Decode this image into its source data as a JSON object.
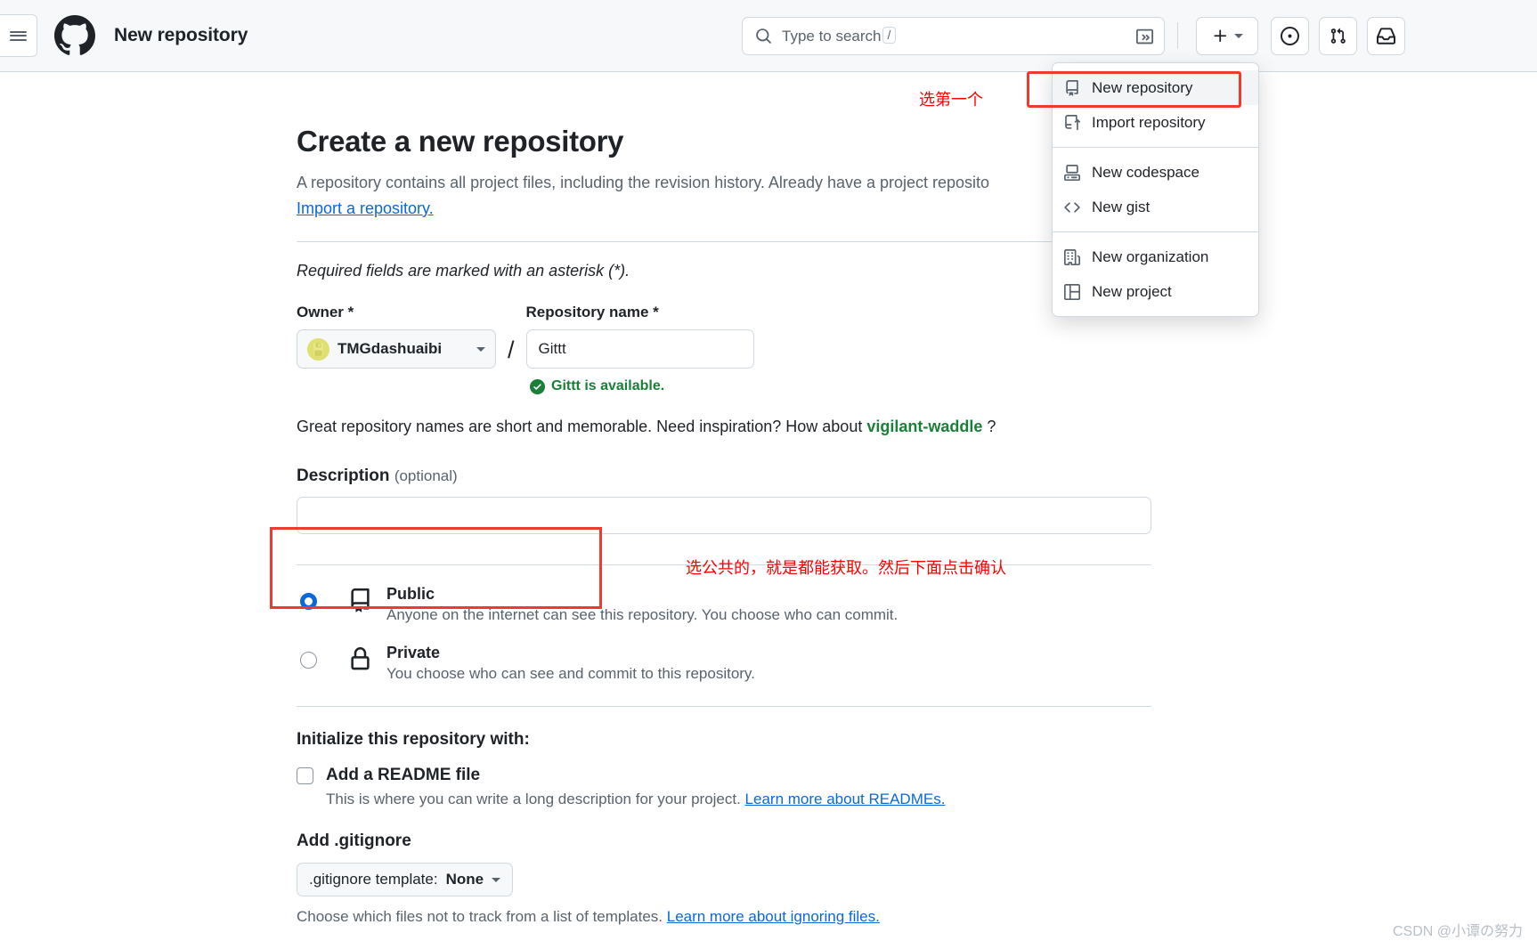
{
  "header": {
    "title": "New repository",
    "menu_icon": "hamburger-icon",
    "logo_icon": "github-logo-icon",
    "buttons": [
      {
        "name": "create-new-button",
        "icon": "plus-icon",
        "has_caret": true
      },
      {
        "name": "issues-button",
        "icon": "issue-opened-icon"
      },
      {
        "name": "pull-requests-button",
        "icon": "git-pull-request-icon"
      },
      {
        "name": "notifications-button",
        "icon": "inbox-icon"
      }
    ]
  },
  "search": {
    "placeholder": "Type to search",
    "shortcut_key": "/",
    "icon": "search-icon",
    "command_icon": "terminal-icon"
  },
  "dropdown": {
    "groups": [
      {
        "items": [
          {
            "label": "New repository",
            "icon": "repo-icon",
            "active": true
          },
          {
            "label": "Import repository",
            "icon": "repo-push-icon",
            "active": false
          }
        ]
      },
      {
        "items": [
          {
            "label": "New codespace",
            "icon": "codespaces-icon",
            "active": false
          },
          {
            "label": "New gist",
            "icon": "code-icon",
            "active": false
          }
        ]
      },
      {
        "items": [
          {
            "label": "New organization",
            "icon": "organization-icon",
            "active": false
          },
          {
            "label": "New project",
            "icon": "project-icon",
            "active": false
          }
        ]
      }
    ]
  },
  "main": {
    "title": "Create a new repository",
    "lede_text": "A repository contains all project files, including the revision history. Already have a project reposito",
    "lede_link": "Import a repository.",
    "required_note": "Required fields are marked with an asterisk (*).",
    "owner": {
      "label": "Owner *",
      "value": "TMGdashuaibi"
    },
    "separator": "/",
    "repo_name": {
      "label": "Repository name *",
      "value": "Gittt"
    },
    "availability": {
      "text": "Gittt is available.",
      "icon": "check-circle-fill-icon",
      "color": "#1a7f37"
    },
    "inspiration": {
      "prefix": "Great repository names are short and memorable. Need inspiration? How about ",
      "suggestion": "vigilant-waddle",
      "suffix": " ?"
    },
    "description": {
      "label": "Description",
      "optional": "(optional)",
      "value": "",
      "placeholder": ""
    },
    "visibility": [
      {
        "title": "Public",
        "desc": "Anyone on the internet can see this repository. You choose who can commit.",
        "icon": "repo-icon",
        "selected": true
      },
      {
        "title": "Private",
        "desc": "You choose who can see and commit to this repository.",
        "icon": "lock-icon",
        "selected": false
      }
    ],
    "initialize": {
      "title": "Initialize this repository with:",
      "readme_label": "Add a README file",
      "readme_checked": false,
      "readme_help_text": "This is where you can write a long description for your project. ",
      "readme_help_link": "Learn more about READMEs."
    },
    "gitignore": {
      "title": "Add .gitignore",
      "select_prefix": ".gitignore template:",
      "select_value": "None",
      "help_text": "Choose which files not to track from a list of templates. ",
      "help_link": "Learn more about ignoring files."
    }
  },
  "annotations": {
    "dropdown_note": "选第一个",
    "public_note": "选公共的，就是都能获取。然后下面点击确认",
    "color": "#ff0000"
  },
  "watermark": "CSDN @小谭の努力"
}
